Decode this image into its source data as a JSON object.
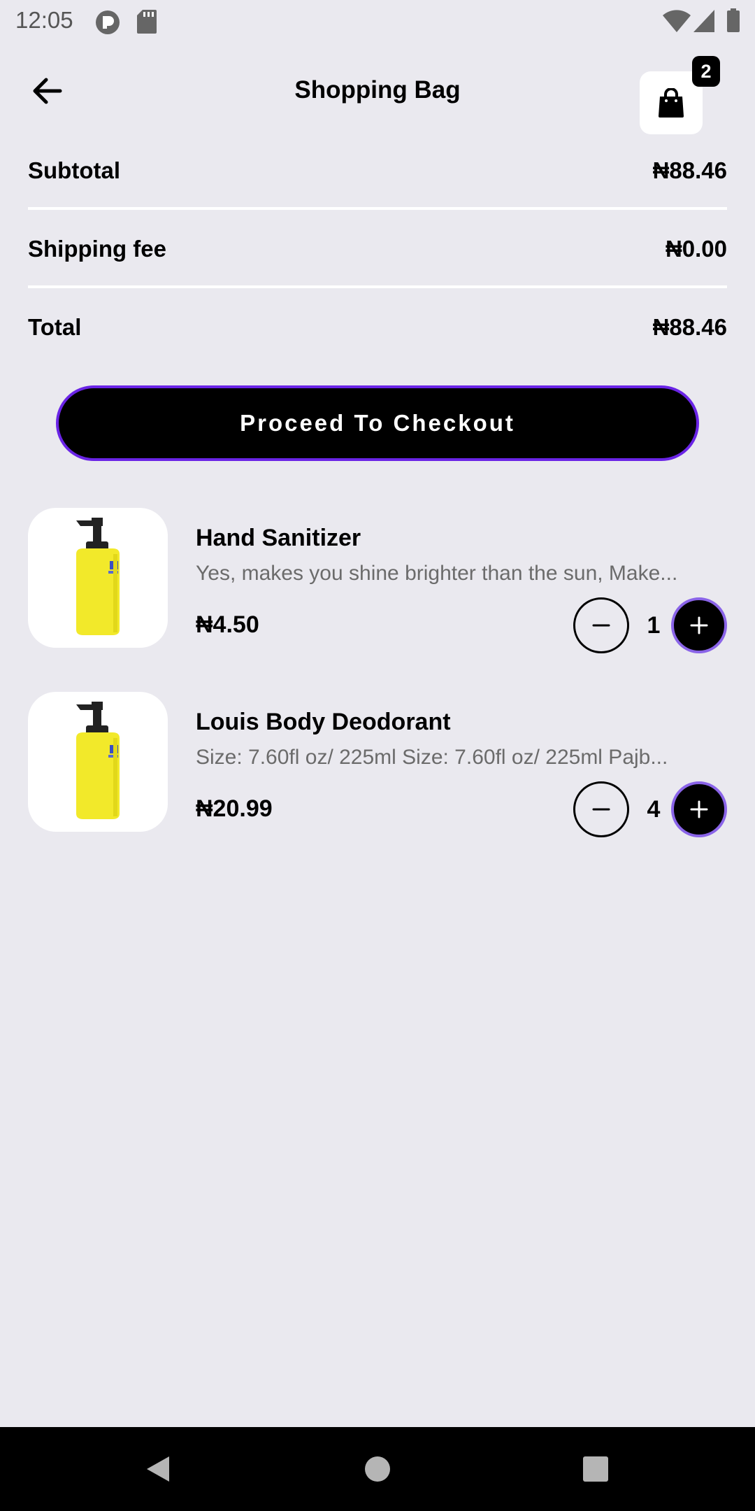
{
  "status_bar": {
    "time": "12:05"
  },
  "app_bar": {
    "title": "Shopping Bag",
    "bag_count": "2",
    "back_icon": "arrow-left-icon",
    "bag_icon": "shopping-bag-icon"
  },
  "summary": {
    "subtotal_label": "Subtotal",
    "subtotal_value": "₦88.46",
    "shipping_label": "Shipping fee",
    "shipping_value": "₦0.00",
    "total_label": "Total",
    "total_value": "₦88.46"
  },
  "checkout": {
    "label": "Proceed To Checkout"
  },
  "cart": {
    "items": [
      {
        "name": "Hand Sanitizer",
        "description": "Yes, makes you shine brighter than the sun, Make...",
        "price": "₦4.50",
        "quantity": "1"
      },
      {
        "name": "Louis Body Deodorant",
        "description": "Size: 7.60fl oz/ 225ml Size: 7.60fl oz/ 225ml Pajb...",
        "price": "₦20.99",
        "quantity": "4"
      }
    ]
  },
  "colors": {
    "background": "#eae9ef",
    "accent": "#6a24e6",
    "primary": "#000000"
  }
}
